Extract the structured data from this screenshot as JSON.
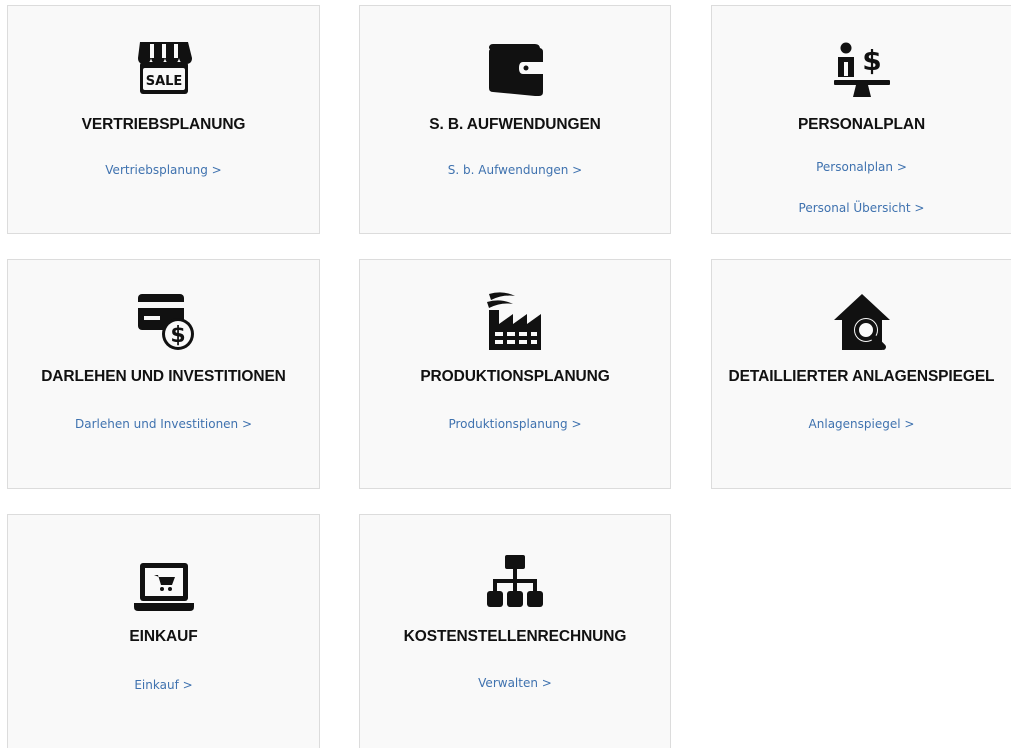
{
  "cards": [
    {
      "title": "VERTRIEBSPLANUNG",
      "icon": "sale-store-icon",
      "links": [
        "Vertriebsplanung >"
      ]
    },
    {
      "title": "S. B. AUFWENDUNGEN",
      "icon": "wallet-icon",
      "links": [
        "S. b. Aufwendungen >"
      ]
    },
    {
      "title": "PERSONALPLAN",
      "icon": "person-salary-balance-icon",
      "links": [
        "Personalplan >",
        "Personal Übersicht >"
      ]
    },
    {
      "title": "DARLEHEN UND INVESTITIONEN",
      "icon": "credit-card-dollar-icon",
      "links": [
        "Darlehen und Investitionen >"
      ]
    },
    {
      "title": "PRODUKTIONSPLANUNG",
      "icon": "factory-icon",
      "links": [
        "Produktionsplanung >"
      ]
    },
    {
      "title": "DETAILLIERTER ANLAGENSPIEGEL",
      "icon": "house-search-icon",
      "links": [
        "Anlagenspiegel >"
      ]
    },
    {
      "title": "EINKAUF",
      "icon": "laptop-cart-icon",
      "links": [
        "Einkauf >"
      ]
    },
    {
      "title": "KOSTENSTELLENRECHNUNG",
      "icon": "org-chart-icon",
      "links": [
        "Verwalten >"
      ]
    }
  ],
  "colors": {
    "card_background": "#f9f9f9",
    "card_border": "#dcdcdc",
    "title": "#111111",
    "link": "#3f72af",
    "icon": "#111111"
  }
}
